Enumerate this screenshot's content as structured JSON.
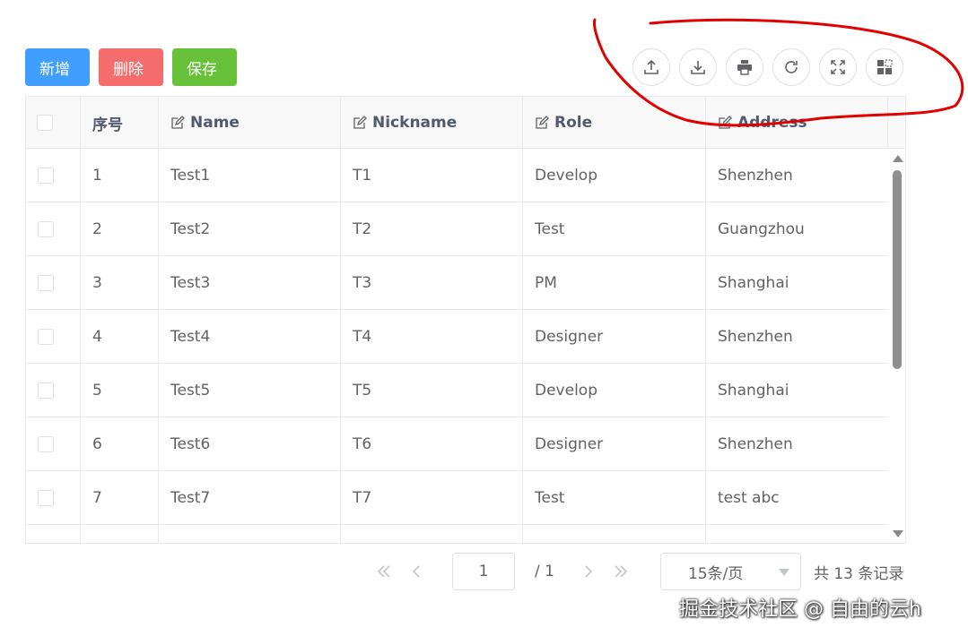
{
  "toolbar": {
    "add_label": "新增",
    "delete_label": "删除",
    "save_label": "保存",
    "colors": {
      "add": "#409eff",
      "delete": "#f56c6c",
      "save": "#67c23a"
    }
  },
  "tools": [
    "upload-icon",
    "download-icon",
    "print-icon",
    "refresh-icon",
    "fullscreen-icon",
    "columns-icon"
  ],
  "table": {
    "columns": [
      "序号",
      "Name",
      "Nickname",
      "Role",
      "Address"
    ],
    "rows": [
      {
        "seq": "1",
        "name": "Test1",
        "nickname": "T1",
        "role": "Develop",
        "address": "Shenzhen"
      },
      {
        "seq": "2",
        "name": "Test2",
        "nickname": "T2",
        "role": "Test",
        "address": "Guangzhou"
      },
      {
        "seq": "3",
        "name": "Test3",
        "nickname": "T3",
        "role": "PM",
        "address": "Shanghai"
      },
      {
        "seq": "4",
        "name": "Test4",
        "nickname": "T4",
        "role": "Designer",
        "address": "Shenzhen"
      },
      {
        "seq": "5",
        "name": "Test5",
        "nickname": "T5",
        "role": "Develop",
        "address": "Shanghai"
      },
      {
        "seq": "6",
        "name": "Test6",
        "nickname": "T6",
        "role": "Designer",
        "address": "Shenzhen"
      },
      {
        "seq": "7",
        "name": "Test7",
        "nickname": "T7",
        "role": "Test",
        "address": "test abc"
      }
    ]
  },
  "pager": {
    "current_page": "1",
    "total_pages": "/ 1",
    "page_size": "15条/页",
    "total": "共 13 条记录"
  },
  "watermark": "掘金技术社区 @ 自由的云h",
  "annotation_color": "#e00000"
}
